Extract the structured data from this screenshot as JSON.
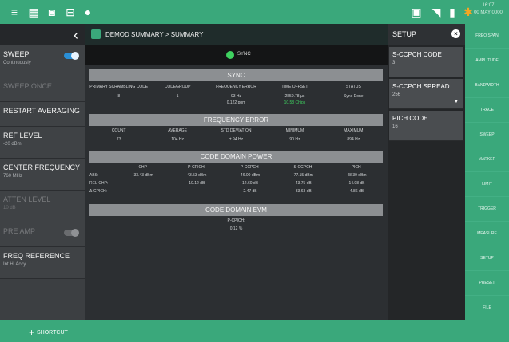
{
  "topbar": {
    "icons": [
      "menu-icon",
      "grid-icon",
      "camera-icon",
      "save-icon",
      "marker-icon"
    ],
    "status_icons": [
      "screen-icon",
      "wifi-icon",
      "battery-icon",
      "gps-icon"
    ],
    "datetime": "16:07\n00 MAY 0000"
  },
  "left_panel": {
    "items": [
      {
        "label": "SWEEP",
        "sub": "Continuously",
        "toggle": "on"
      },
      {
        "label": "SWEEP ONCE",
        "sub": "",
        "dim": true
      },
      {
        "label": "RESTART AVERAGING",
        "sub": ""
      },
      {
        "label": "REF LEVEL",
        "sub": "-20 dBm"
      },
      {
        "label": "CENTER FREQUENCY",
        "sub": "760 MHz"
      },
      {
        "label": "ATTEN LEVEL",
        "sub": "10 dB",
        "dim": true
      },
      {
        "label": "PRE AMP",
        "sub": "",
        "dim": true,
        "toggle": "off"
      },
      {
        "label": "FREQ REFERENCE",
        "sub": "Int Hi Accy"
      }
    ]
  },
  "center": {
    "breadcrumb": "DEMOD SUMMARY  >  SUMMARY",
    "sync_status": "SYNC",
    "sync_section": {
      "title": "SYNC",
      "headers": [
        "PRIMARY SCRAMBLING CODE",
        "CODEGROUP",
        "FREQUENCY ERROR",
        "TIME OFFSET",
        "STATUS"
      ],
      "values": [
        "8",
        "1",
        "93 Hz",
        "2859.78 µs",
        "Sync Done"
      ],
      "values2": [
        "",
        "",
        "0.122 ppm",
        "10.58 Chips",
        ""
      ]
    },
    "freq_error_section": {
      "title": "FREQUENCY ERROR",
      "headers": [
        "COUNT",
        "AVERAGE",
        "STD DEVIATION",
        "MINIMUM",
        "MAXIMUM"
      ],
      "values": [
        "73",
        "104 Hz",
        "± 94 Hz",
        "90 Hz",
        "894 Hz"
      ]
    },
    "code_domain_power": {
      "title": "CODE DOMAIN POWER",
      "headers": [
        "",
        "CHP",
        "P-CPICH",
        "P-CCPCH",
        "S-CCPCH",
        "PICH"
      ],
      "rows": [
        [
          "ABS:",
          "-33.43 dBm",
          "-43.53 dBm",
          "-46.00 dBm",
          "-77.15 dBm",
          "-48.39 dBm"
        ],
        [
          "REL-CHP:",
          "",
          "-10.12 dB",
          "-12.60 dB",
          "-43.75 dB",
          "-14.98 dB"
        ],
        [
          "Δ-CPICH:",
          "",
          "",
          "-2.47 dB",
          "-33.63 dB",
          "-4.86 dB"
        ]
      ]
    },
    "code_domain_evm": {
      "title": "CODE DOMAIN EVM",
      "label": "P-CPICH:",
      "value": "0.12 %"
    }
  },
  "setup": {
    "title": "SETUP",
    "items": [
      {
        "label": "S-CCPCH CODE",
        "value": "3"
      },
      {
        "label": "S-CCPCH SPREAD",
        "value": "256"
      },
      {
        "label": "PICH CODE",
        "value": "16"
      }
    ]
  },
  "right_menu": [
    "FREQ SPAN",
    "AMPLITUDE",
    "BANDWIDTH",
    "TRACE",
    "SWEEP",
    "MARKER",
    "LIMIT",
    "TRIGGER",
    "MEASURE",
    "SETUP",
    "PRESET",
    "FILE"
  ],
  "bottom": {
    "shortcut_label": "SHORTCUT"
  },
  "colors": {
    "accent": "#3aa87b",
    "sync_ok": "#3fd160",
    "toggle_on": "#2a8fd6"
  }
}
